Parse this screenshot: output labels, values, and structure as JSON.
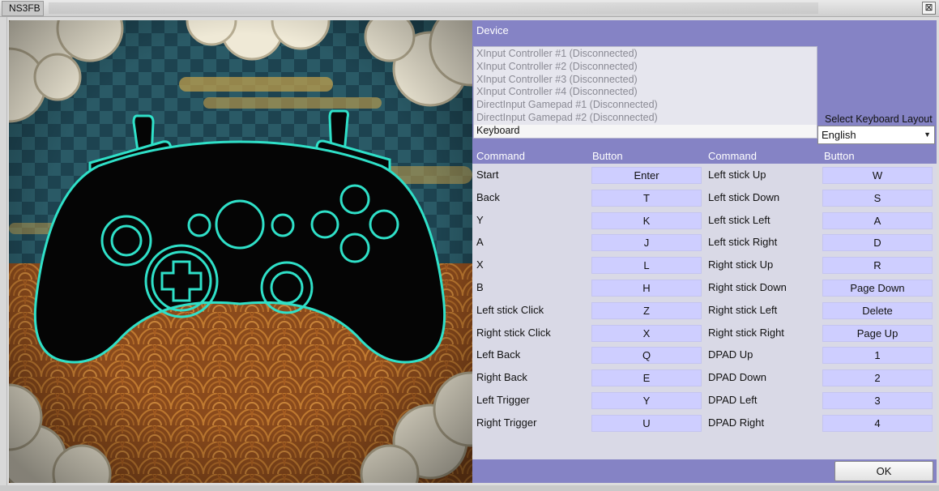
{
  "window": {
    "title": "NS3FB",
    "close_glyph": "⊠"
  },
  "device": {
    "label": "Device",
    "items": [
      "XInput Controller #1 (Disconnected)",
      "XInput Controller #2 (Disconnected)",
      "XInput Controller #3 (Disconnected)",
      "XInput Controller #4 (Disconnected)",
      "DirectInput Gamepad #1 (Disconnected)",
      "DirectInput Gamepad #2 (Disconnected)",
      "Keyboard"
    ],
    "selected_index": 6
  },
  "layout": {
    "label": "Select Keyboard Layout",
    "value": "English"
  },
  "table": {
    "headers": {
      "command": "Command",
      "button": "Button"
    },
    "left": [
      {
        "command": "Start",
        "button": "Enter"
      },
      {
        "command": "Back",
        "button": "T"
      },
      {
        "command": "Y",
        "button": "K"
      },
      {
        "command": "A",
        "button": "J"
      },
      {
        "command": "X",
        "button": "L"
      },
      {
        "command": "B",
        "button": "H"
      },
      {
        "command": "Left stick Click",
        "button": "Z"
      },
      {
        "command": "Right stick Click",
        "button": "X"
      },
      {
        "command": "Left Back",
        "button": "Q"
      },
      {
        "command": "Right Back",
        "button": "E"
      },
      {
        "command": "Left Trigger",
        "button": "Y"
      },
      {
        "command": "Right Trigger",
        "button": "U"
      }
    ],
    "right": [
      {
        "command": "Left stick Up",
        "button": "W"
      },
      {
        "command": "Left stick Down",
        "button": "S"
      },
      {
        "command": "Left stick Left",
        "button": "A"
      },
      {
        "command": "Left stick Right",
        "button": "D"
      },
      {
        "command": "Right stick Up",
        "button": "R"
      },
      {
        "command": "Right stick Down",
        "button": "Page Down"
      },
      {
        "command": "Right stick Left",
        "button": "Delete"
      },
      {
        "command": "Right stick Right",
        "button": "Page Up"
      },
      {
        "command": "DPAD Up",
        "button": "1"
      },
      {
        "command": "DPAD Down",
        "button": "2"
      },
      {
        "command": "DPAD Left",
        "button": "3"
      },
      {
        "command": "DPAD Right",
        "button": "4"
      }
    ]
  },
  "footer": {
    "ok_label": "OK"
  },
  "art": {
    "icon": "gamepad-icon",
    "outline_color": "#2fe0c8",
    "body_color": "#050505"
  }
}
